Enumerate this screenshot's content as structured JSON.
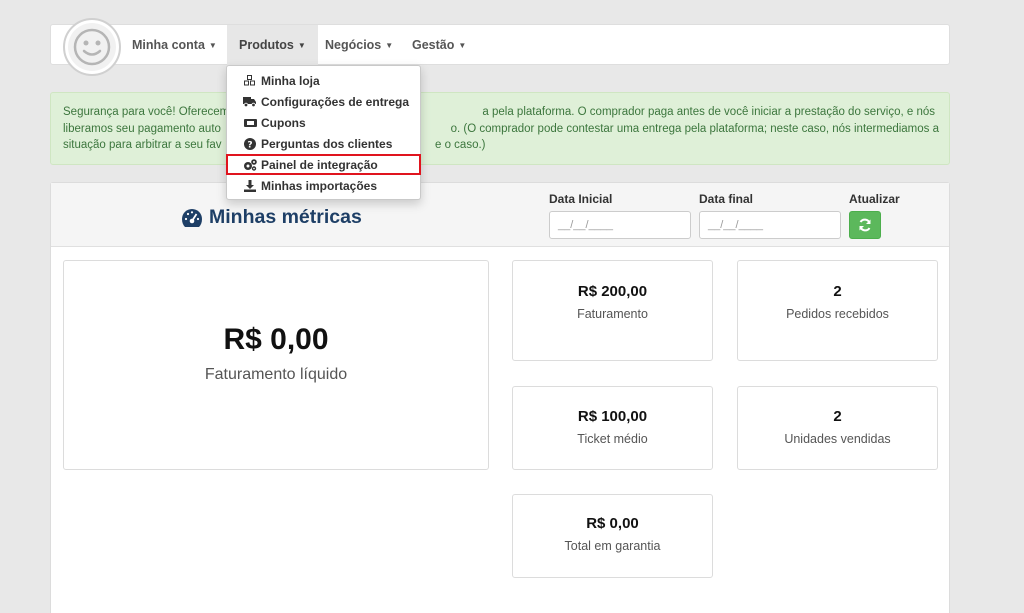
{
  "nav": {
    "items": [
      {
        "label": "Minha conta"
      },
      {
        "label": "Produtos"
      },
      {
        "label": "Negócios"
      },
      {
        "label": "Gestão"
      }
    ]
  },
  "dropdown": {
    "items": [
      {
        "label": "Minha loja",
        "icon": "cubes-icon"
      },
      {
        "label": "Configurações de entrega",
        "icon": "truck-icon"
      },
      {
        "label": "Cupons",
        "icon": "ticket-icon"
      },
      {
        "label": "Perguntas dos clientes",
        "icon": "question-circle-icon"
      },
      {
        "label": "Painel de integração",
        "icon": "cogs-icon"
      },
      {
        "label": "Minhas importações",
        "icon": "download-icon"
      }
    ]
  },
  "alert": {
    "line1_left": "Segurança para você! Oferecem",
    "line1_right": "a pela plataforma. O comprador paga antes de você iniciar a prestação do serviço, e nós",
    "line2_left": "liberamos seu pagamento auto",
    "line2_right": "o. (O comprador pode contestar uma entrega pela plataforma; neste caso, nós intermediamos a",
    "line3_left": "situação para arbitrar a seu fav",
    "line3_right": "e o caso.)"
  },
  "metrics": {
    "title": "Minhas métricas",
    "date_start_label": "Data Inicial",
    "date_start_placeholder": "__/__/____",
    "date_end_label": "Data final",
    "date_end_placeholder": "__/__/____",
    "refresh_label": "Atualizar",
    "cards": {
      "liquido": {
        "value": "R$ 0,00",
        "label": "Faturamento líquido"
      },
      "faturamento": {
        "value": "R$ 200,00",
        "label": "Faturamento"
      },
      "pedidos": {
        "value": "2",
        "label": "Pedidos recebidos"
      },
      "ticket": {
        "value": "R$ 100,00",
        "label": "Ticket médio"
      },
      "unidades": {
        "value": "2",
        "label": "Unidades vendidas"
      },
      "garantia": {
        "value": "R$ 0,00",
        "label": "Total em garantia"
      }
    }
  },
  "colors": {
    "accent_title": "#1e3f66",
    "alert_bg": "#dff0d8",
    "alert_text": "#3c763d",
    "button_green": "#5cb85c",
    "highlight_red": "#e0141e"
  }
}
